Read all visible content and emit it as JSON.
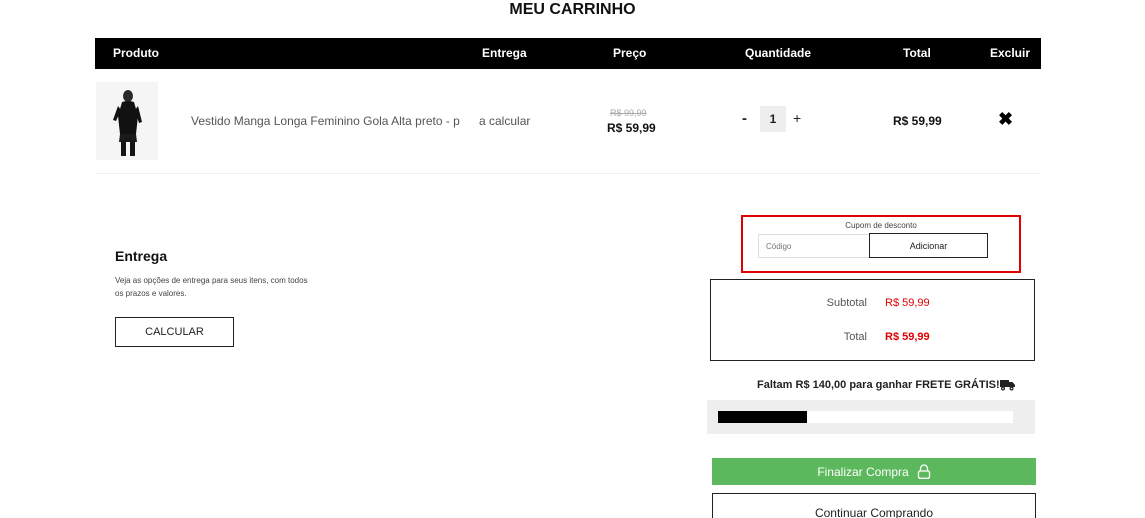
{
  "page": {
    "title": "MEU CARRINHO"
  },
  "table": {
    "headers": [
      "Produto",
      "Entrega",
      "Preço",
      "Quantidade",
      "Total",
      "Excluir"
    ]
  },
  "items": [
    {
      "name": "Vestido Manga Longa Feminino Gola Alta preto - p",
      "delivery": "a calcular",
      "price_old": "R$ 99,99",
      "price_new": "R$ 59,99",
      "quantity": "1",
      "qty_minus": "-",
      "qty_plus": "+",
      "total": "R$ 59,99",
      "remove_icon": "close-x-icon"
    }
  ],
  "coupon": {
    "label": "Cupom de desconto",
    "placeholder": "Código",
    "button": "Adicionar",
    "highlight_color": "#e00000"
  },
  "shipping": {
    "title": "Entrega",
    "description": "Veja as opções de entrega para seus itens, com todos os prazos e valores.",
    "button": "CALCULAR"
  },
  "summary": {
    "subtotal_label": "Subtotal",
    "subtotal_value": "R$ 59,99",
    "total_label": "Total",
    "total_value": "R$ 59,99",
    "value_color": "#e00000"
  },
  "free_shipping": {
    "message": "Faltam R$ 140,00 para ganhar FRETE GRÁTIS!",
    "icon": "truck-icon",
    "progress": 0.3
  },
  "actions": {
    "checkout": "Finalizar Compra",
    "checkout_icon": "lock-icon",
    "checkout_color": "#5cb85c",
    "continue": "Continuar Comprando"
  }
}
